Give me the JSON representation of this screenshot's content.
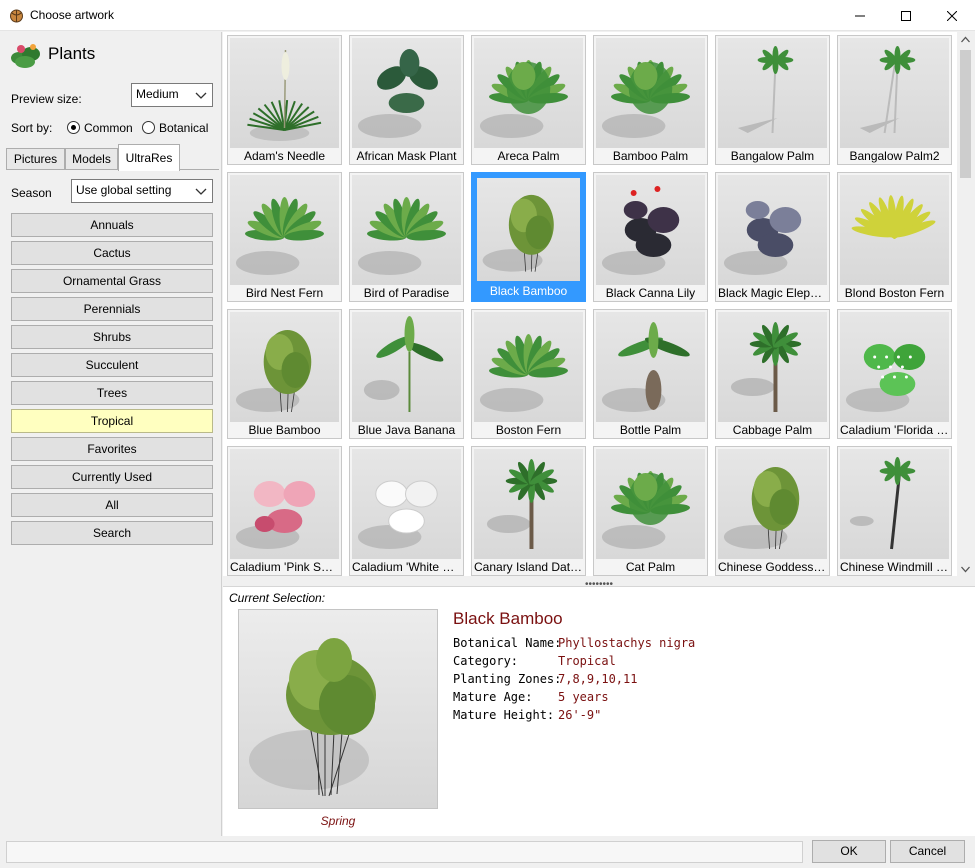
{
  "window": {
    "title": "Choose artwork"
  },
  "left": {
    "category_title": "Plants",
    "preview_size_label": "Preview size:",
    "preview_size_value": "Medium",
    "sort_by_label": "Sort by:",
    "sort_common": "Common",
    "sort_botanical": "Botanical",
    "sort_selected": "Common",
    "tabs": [
      "Pictures",
      "Models",
      "UltraRes"
    ],
    "active_tab": "UltraRes",
    "season_label": "Season",
    "season_value": "Use global setting",
    "categories": [
      "Annuals",
      "Cactus",
      "Ornamental Grass",
      "Perennials",
      "Shrubs",
      "Succulent",
      "Trees",
      "Tropical",
      "Favorites",
      "Currently Used",
      "All",
      "Search"
    ],
    "selected_category": "Tropical"
  },
  "grid": {
    "items": [
      {
        "label": "Adam's Needle",
        "type": "spiky"
      },
      {
        "label": "African Mask Plant",
        "type": "bigleaf"
      },
      {
        "label": "Areca Palm",
        "type": "bush"
      },
      {
        "label": "Bamboo Palm",
        "type": "bush"
      },
      {
        "label": "Bangalow Palm",
        "type": "palm"
      },
      {
        "label": "Bangalow Palm2",
        "type": "palm2"
      },
      {
        "label": "Bird Nest Fern",
        "type": "fern"
      },
      {
        "label": "Bird of Paradise",
        "type": "fern"
      },
      {
        "label": "Black Bamboo",
        "type": "bamboo"
      },
      {
        "label": "Black Canna Lily",
        "type": "darkleaf"
      },
      {
        "label": "Black Magic Elephan...",
        "type": "darkleaf2"
      },
      {
        "label": "Blond Boston Fern",
        "type": "yellowfern"
      },
      {
        "label": "Blue Bamboo",
        "type": "bamboo"
      },
      {
        "label": "Blue Java Banana",
        "type": "banana"
      },
      {
        "label": "Boston Fern",
        "type": "fern"
      },
      {
        "label": "Bottle Palm",
        "type": "bottle"
      },
      {
        "label": "Cabbage Palm",
        "type": "cabbage"
      },
      {
        "label": "Caladium 'Florida Clo...",
        "type": "caladium"
      },
      {
        "label": "Caladium 'Pink Splash'",
        "type": "pink"
      },
      {
        "label": "Caladium 'White Frost'",
        "type": "white"
      },
      {
        "label": "Canary Island Date P...",
        "type": "datepalm"
      },
      {
        "label": "Cat Palm",
        "type": "bush"
      },
      {
        "label": "Chinese Goddess Ba...",
        "type": "shrub"
      },
      {
        "label": "Chinese Windmill Palm",
        "type": "windmill"
      }
    ],
    "selected_index": 8
  },
  "current": {
    "label": "Current Selection:",
    "name": "Black Bamboo",
    "season": "Spring",
    "fields": [
      {
        "key": "Botanical Name:",
        "value": "Phyllostachys nigra"
      },
      {
        "key": "Category:",
        "value": "Tropical"
      },
      {
        "key": "Planting Zones:",
        "value": "7,8,9,10,11"
      },
      {
        "key": "Mature Age:",
        "value": "5 years"
      },
      {
        "key": "Mature Height:",
        "value": "26'-9\""
      }
    ]
  },
  "buttons": {
    "ok": "OK",
    "cancel": "Cancel"
  },
  "colors": {
    "accent": "#3399ff",
    "info_text": "#7a1010",
    "selected_category": "#ffffc0"
  }
}
